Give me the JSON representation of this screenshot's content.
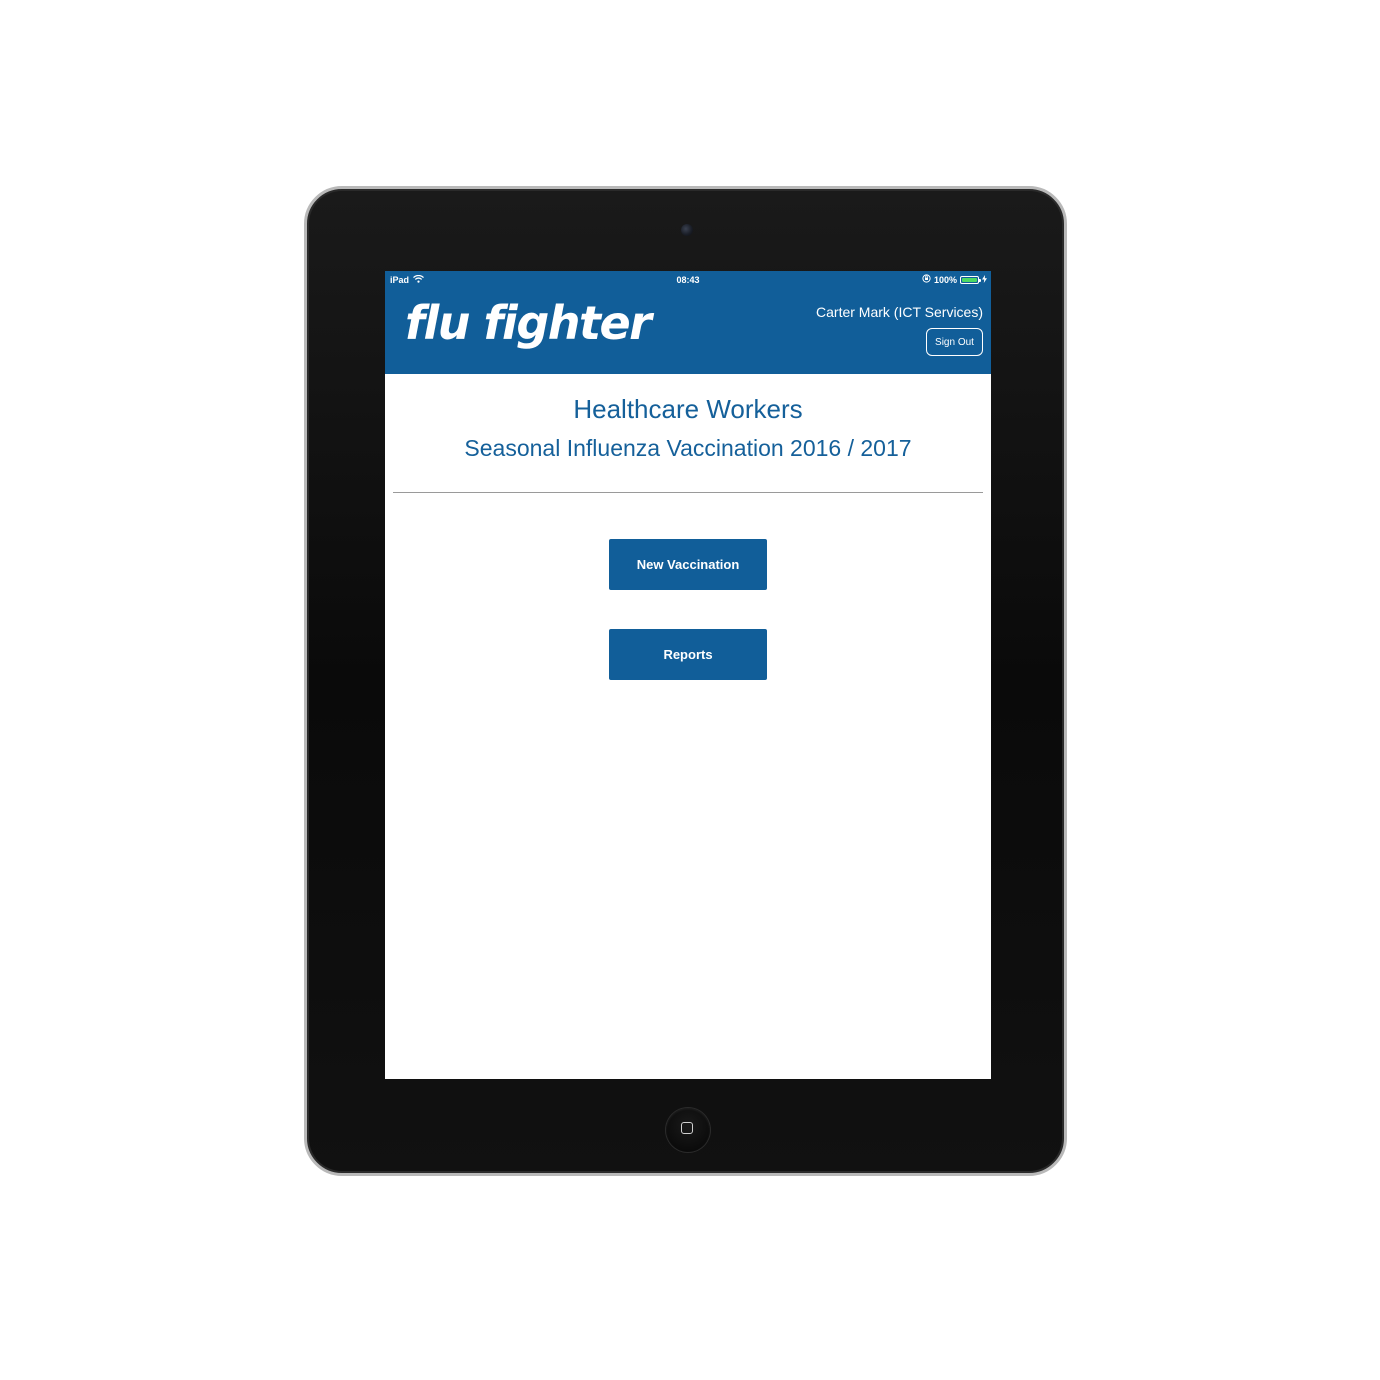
{
  "status_bar": {
    "device": "iPad",
    "time": "08:43",
    "battery": "100%",
    "battery_level": 1.0,
    "icons": [
      "wifi-icon",
      "orientation-lock-icon",
      "battery-icon",
      "charging-icon"
    ]
  },
  "header": {
    "logo": "flu fighter",
    "user": "Carter Mark (ICT Services)",
    "sign_out": "Sign Out"
  },
  "main": {
    "title": "Healthcare Workers",
    "subtitle": "Seasonal Influenza Vaccination 2016 / 2017",
    "buttons": {
      "new_vaccination": "New Vaccination",
      "reports": "Reports"
    }
  },
  "colors": {
    "brand_blue": "#115e99",
    "text_blue": "#15609a",
    "battery_green": "#4cd964"
  }
}
